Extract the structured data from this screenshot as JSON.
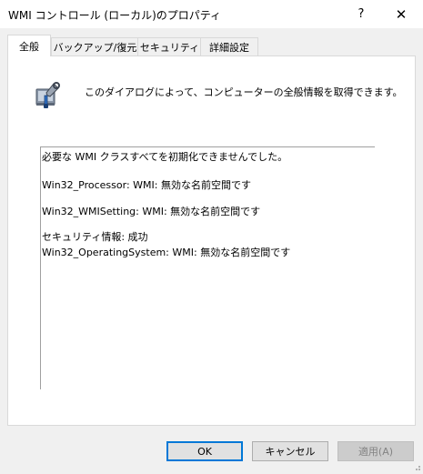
{
  "window": {
    "title": "WMI コントロール (ローカル)のプロパティ",
    "help_glyph": "?",
    "close_glyph": "✕"
  },
  "tabs": [
    {
      "label": "全般",
      "active": true
    },
    {
      "label": "バックアップ/復元",
      "active": false
    },
    {
      "label": "セキュリティ",
      "active": false
    },
    {
      "label": "詳細設定",
      "active": false
    }
  ],
  "general": {
    "icon": "wmi-control-icon",
    "description": "このダイアログによって、コンピューターの全般情報を取得できます。",
    "info_lines": [
      "必要な WMI クラスすべてを初期化できませんでした。",
      "",
      "Win32_Processor: WMI: 無効な名前空間です",
      "",
      "Win32_WMISetting: WMI: 無効な名前空間です",
      "",
      "セキュリティ情報: 成功",
      "Win32_OperatingSystem: WMI: 無効な名前空間です"
    ]
  },
  "buttons": {
    "ok": "OK",
    "cancel": "キャンセル",
    "apply": "適用(A)"
  },
  "colors": {
    "accent": "#0078d7",
    "panel": "#ffffff",
    "dialog": "#f0f0f0"
  }
}
